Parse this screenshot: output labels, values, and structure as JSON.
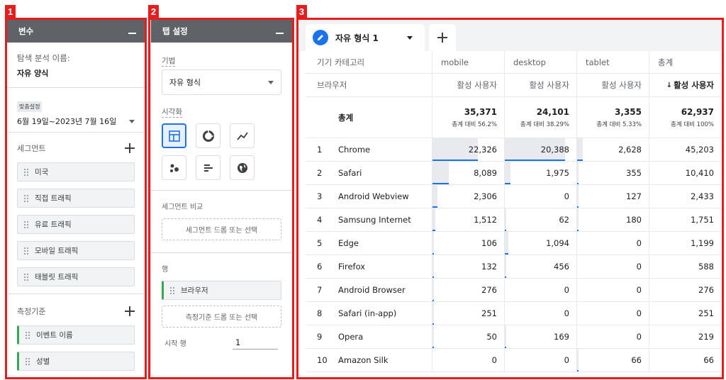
{
  "badges": {
    "b1": "1",
    "b2": "2",
    "b3": "3"
  },
  "variables": {
    "header": "변수",
    "exploration_label": "탐색 분석 이름:",
    "exploration_name": "자유 양식",
    "date_tag": "맞춤설정",
    "date_range": "6월 19일~2023년 7월 16일",
    "segments_title": "세그먼트",
    "segments": [
      "미국",
      "직접 트래픽",
      "유료 트래픽",
      "모바일 트래픽",
      "태블릿 트래픽"
    ],
    "metrics_title": "측정기준",
    "dimensions": [
      "이벤트 이름",
      "성별"
    ]
  },
  "tab_settings": {
    "header": "탭 설정",
    "technique_label": "기법",
    "technique_value": "자유 형식",
    "viz_label": "시각화",
    "viz_icons": [
      "table-icon",
      "donut-chart-icon",
      "line-chart-icon",
      "scatter-icon",
      "bar-chart-icon",
      "globe-icon"
    ],
    "segment_compare_label": "세그먼트 비교",
    "segment_drop": "세그먼트 드롭 또는 선택",
    "rows_label": "행",
    "row_chip": "브라우저",
    "dimension_drop": "측정기준 드롭 또는 선택",
    "start_row_label": "시작 행",
    "start_row_value": "1"
  },
  "report": {
    "tab_name": "자유 형식 1",
    "header_row1": {
      "label": "기기 카테고리",
      "cols": [
        "mobile",
        "desktop",
        "tablet",
        "총계"
      ]
    },
    "header_row2": {
      "label": "브라우저",
      "cols": [
        "활성 사용자",
        "활성 사용자",
        "활성 사용자",
        "활성 사용자"
      ],
      "sort_arrow": "↓"
    },
    "total": {
      "label": "총계",
      "values": [
        "35,371",
        "24,101",
        "3,355",
        "62,937"
      ],
      "pcts": [
        "총계 대비 56.2%",
        "총계 대비 38.29%",
        "총계 대비 5.33%",
        "총계 대비 100%"
      ]
    },
    "rows": [
      {
        "i": "1",
        "name": "Chrome",
        "v": [
          "22,326",
          "20,388",
          "2,628",
          "45,203"
        ],
        "share": [
          0.631,
          0.846,
          0.078
        ]
      },
      {
        "i": "2",
        "name": "Safari",
        "v": [
          "8,089",
          "1,975",
          "355",
          "10,410"
        ],
        "share": [
          0.229,
          0.082,
          0.011
        ]
      },
      {
        "i": "3",
        "name": "Android Webview",
        "v": [
          "2,306",
          "0",
          "127",
          "2,433"
        ],
        "share": [
          0.065,
          0,
          0.004
        ]
      },
      {
        "i": "4",
        "name": "Samsung Internet",
        "v": [
          "1,512",
          "62",
          "180",
          "1,751"
        ],
        "share": [
          0.043,
          0.003,
          0.005
        ]
      },
      {
        "i": "5",
        "name": "Edge",
        "v": [
          "106",
          "1,094",
          "0",
          "1,199"
        ],
        "share": [
          0.003,
          0.045,
          0
        ]
      },
      {
        "i": "6",
        "name": "Firefox",
        "v": [
          "132",
          "456",
          "0",
          "588"
        ],
        "share": [
          0.004,
          0.019,
          0
        ]
      },
      {
        "i": "7",
        "name": "Android Browser",
        "v": [
          "276",
          "0",
          "0",
          "276"
        ],
        "share": [
          0.008,
          0,
          0
        ]
      },
      {
        "i": "8",
        "name": "Safari (in-app)",
        "v": [
          "251",
          "0",
          "0",
          "251"
        ],
        "share": [
          0.007,
          0,
          0
        ]
      },
      {
        "i": "9",
        "name": "Opera",
        "v": [
          "50",
          "169",
          "0",
          "219"
        ],
        "share": [
          0.001,
          0.007,
          0
        ]
      },
      {
        "i": "10",
        "name": "Amazon Silk",
        "v": [
          "0",
          "0",
          "66",
          "66"
        ],
        "share": [
          0,
          0,
          0.002
        ]
      }
    ]
  },
  "colors": {
    "highlight": "#e51d1d",
    "accent": "#1a73e8",
    "header_bg": "#5f6368"
  }
}
